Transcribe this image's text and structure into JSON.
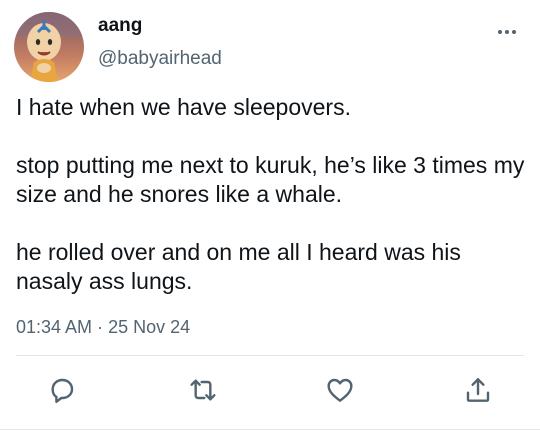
{
  "user": {
    "display_name": "aang",
    "handle": "@babyairhead",
    "avatar_icon": "user-avatar-icon"
  },
  "tweet": {
    "text": "I hate when we have sleepovers.\n\nstop putting me next to kuruk, he’s like 3 times my size and he snores like a whale.\n\nhe rolled over and on me all I heard was his nasaly ass lungs.",
    "time": "01:34 AM",
    "separator": "·",
    "date": "25 Nov 24"
  },
  "actions": {
    "icons": [
      "reply-icon",
      "retweet-icon",
      "like-icon",
      "share-icon"
    ],
    "color": "#536471"
  },
  "colors": {
    "text": "#0f1419",
    "secondary": "#536471",
    "divider": "#e1e6ea"
  }
}
